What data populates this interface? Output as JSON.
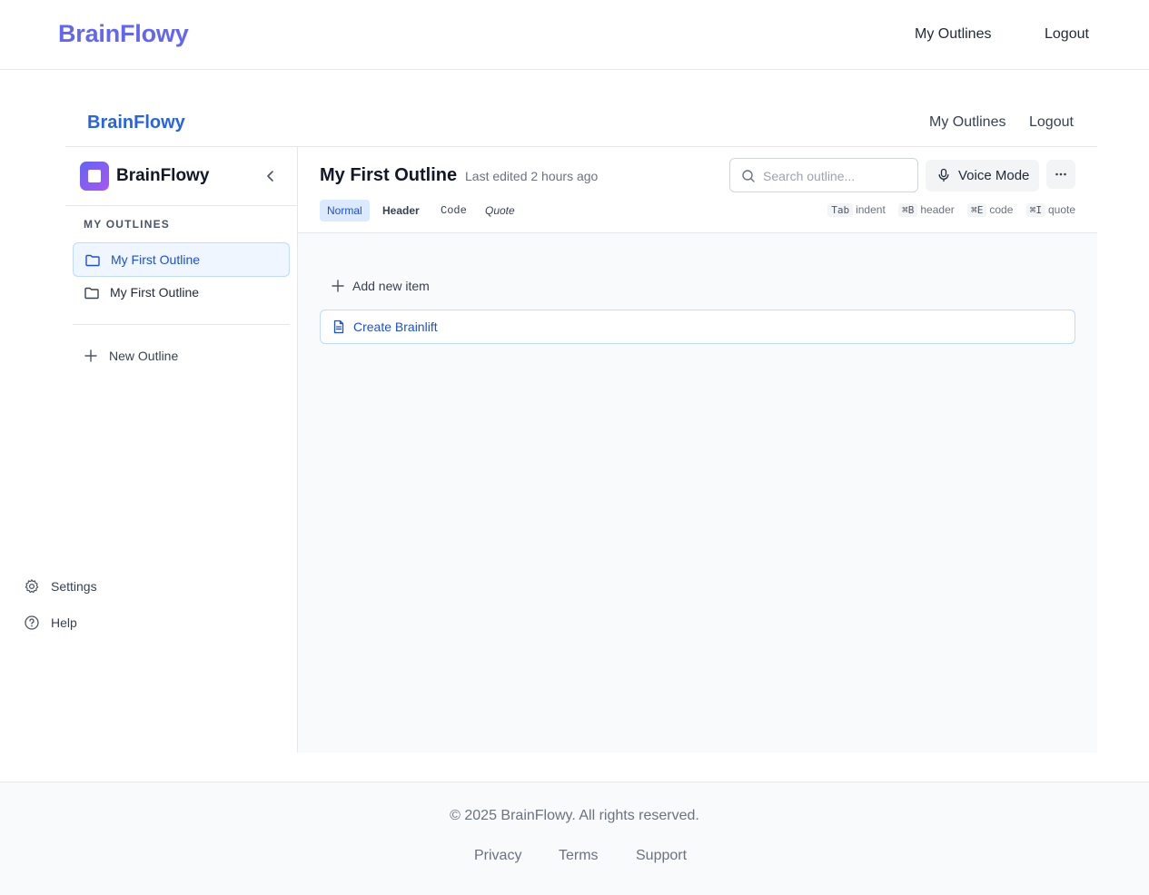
{
  "topbar": {
    "brand": "BrainFlowy",
    "nav_outlines": "My Outlines",
    "nav_logout": "Logout"
  },
  "app_header": {
    "brand": "BrainFlowy",
    "nav_outlines": "My Outlines",
    "nav_logout": "Logout"
  },
  "sidebar": {
    "title": "BrainFlowy",
    "section_label": "MY OUTLINES",
    "items": [
      {
        "label": "My First Outline",
        "active": true,
        "icon": "folder-icon"
      },
      {
        "label": "My First Outline",
        "active": false,
        "icon": "folder-icon"
      }
    ],
    "new_label": "New Outline"
  },
  "utility": {
    "settings": "Settings",
    "help": "Help"
  },
  "editor": {
    "title": "My First Outline",
    "meta": "Last edited 2 hours ago",
    "search_placeholder": "Search outline...",
    "voice_label": "Voice Mode",
    "formats": [
      "Normal",
      "Header",
      "Code",
      "Quote"
    ],
    "hints": [
      {
        "key": "Tab",
        "text": "indent"
      },
      {
        "key": "⌘B",
        "text": "header"
      },
      {
        "key": "⌘E",
        "text": "code"
      },
      {
        "key": "⌘I",
        "text": "quote"
      }
    ],
    "add_item": "Add new item",
    "create_brainlift": "Create Brainlift"
  },
  "footer": {
    "copyright": "© 2025 BrainFlowy. All rights reserved.",
    "links": [
      "Privacy",
      "Terms",
      "Support"
    ]
  },
  "colors": {
    "brand_purple": "#6366f1",
    "brand_blue": "#2563eb",
    "active_bg": "#eff6ff",
    "active_text": "#1d4ed8"
  }
}
